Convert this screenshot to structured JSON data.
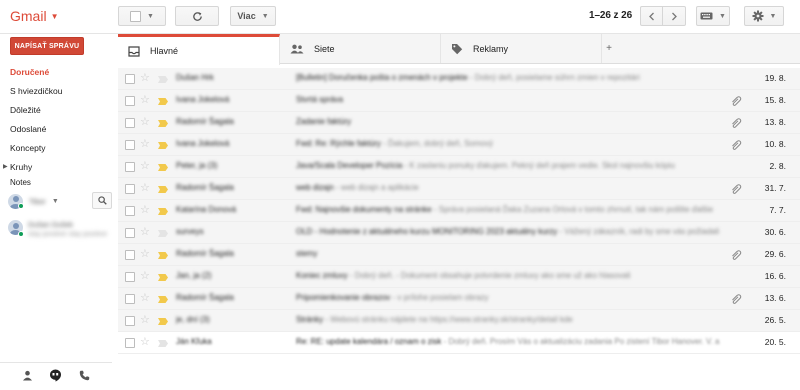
{
  "app": {
    "title": "Gmail"
  },
  "toolbar": {
    "more_label": "Viac",
    "page_count": "1–26 z 26"
  },
  "sidebar": {
    "compose_label": "NAPÍSAŤ SPRÁVU",
    "items": [
      {
        "label": "Doručené",
        "active": true
      },
      {
        "label": "S hviezdičkou"
      },
      {
        "label": "Dôležité"
      },
      {
        "label": "Odoslané"
      },
      {
        "label": "Koncepty"
      },
      {
        "label": "Kruhy",
        "expandable": true
      }
    ],
    "notes_label": "Notes",
    "chat": {
      "self_name": "Tibor",
      "contact_name": "Dušan Dušek",
      "contact_status": "stay positive stay positive"
    }
  },
  "tabs": [
    {
      "label": "Hlavné",
      "icon": "inbox-icon",
      "active": true
    },
    {
      "label": "Siete",
      "icon": "people-icon"
    },
    {
      "label": "Reklamy",
      "icon": "tag-icon"
    }
  ],
  "emails": [
    {
      "sender": "Dušan Hrk",
      "subject": "[Bulletin] Doručenka pošta o zmenách v projekte",
      "snippet": " - Dobrý deň, posielame súhrn zmien v repozitári",
      "date": "19. 8.",
      "important": false,
      "attachment": false
    },
    {
      "sender": "Ivana Jokelová",
      "subject": "Stvrtá správa",
      "snippet": "",
      "date": "15. 8.",
      "important": true,
      "attachment": true
    },
    {
      "sender": "Radomír Šagala",
      "subject": "Zadanie faktúry",
      "snippet": "",
      "date": "13. 8.",
      "important": true,
      "attachment": true
    },
    {
      "sender": "Ivana Jokelová",
      "subject": "Fwd: Re: Rýchle faktúry",
      "snippet": " - Ďakujem, dobrý deň, Somový",
      "date": "10. 8.",
      "important": true,
      "attachment": true
    },
    {
      "sender": "Peter, ja (3)",
      "subject": "Java/Scala Developer Pozícia",
      "snippet": " - K zaslaniu ponuky ďakujem. Pekný deň prajem vedie. Skol najnovšiu kópiu",
      "date": "2. 8.",
      "important": true,
      "attachment": false
    },
    {
      "sender": "Radomír Šagala",
      "subject": "web dizajn",
      "snippet": " - web dizajn a aplikácie",
      "date": "31. 7.",
      "important": true,
      "attachment": true
    },
    {
      "sender": "Katarína Donová",
      "subject": "Fwd: Najnovšie dokumenty na stránke",
      "snippet": " - Správa posielaná Ďaka Zuzana Orlová v tomto zhrnutí, tak nám pošlite ďalšie",
      "date": "7. 7.",
      "important": true,
      "attachment": false
    },
    {
      "sender": "surveys",
      "subject": "OLD - Hodnotenie z aktuálneho kurzu MONITORING 2023 aktuálny kurzy",
      "snippet": " - Vážený zákazník, radi by sme vás požiadali",
      "date": "30. 6.",
      "important": false,
      "attachment": false
    },
    {
      "sender": "Radomír Šagala",
      "subject": "stemy",
      "snippet": "",
      "date": "29. 6.",
      "important": true,
      "attachment": true
    },
    {
      "sender": "Jan, ja (2)",
      "subject": "Koniec zmluvy",
      "snippet": " - Dobrý deň. - Dokument obsahuje potvrdenie zmluvy ako sme už ako hlasovali",
      "date": "16. 6.",
      "important": true,
      "attachment": false
    },
    {
      "sender": "Radomír Šagala",
      "subject": "Pripomienkovanie obrazov",
      "snippet": " - v prílohe posielam obrazy",
      "date": "13. 6.",
      "important": true,
      "attachment": true
    },
    {
      "sender": "je, dní (3)",
      "subject": "Stránky",
      "snippet": " - Webovú stránku nájdete na https://www.stranky.sk/stranky/detail kde",
      "date": "26. 5.",
      "important": true,
      "attachment": false
    },
    {
      "sender": "Ján Kľuka",
      "subject": "Re: RE: update kalendára / oznam o zisk",
      "snippet": " - Dobrý deň. Prosím Vás o aktualizáciu zadania Po zistení Tibor Hanover. V. a",
      "date": "20. 5.",
      "important": false,
      "attachment": false
    }
  ]
}
